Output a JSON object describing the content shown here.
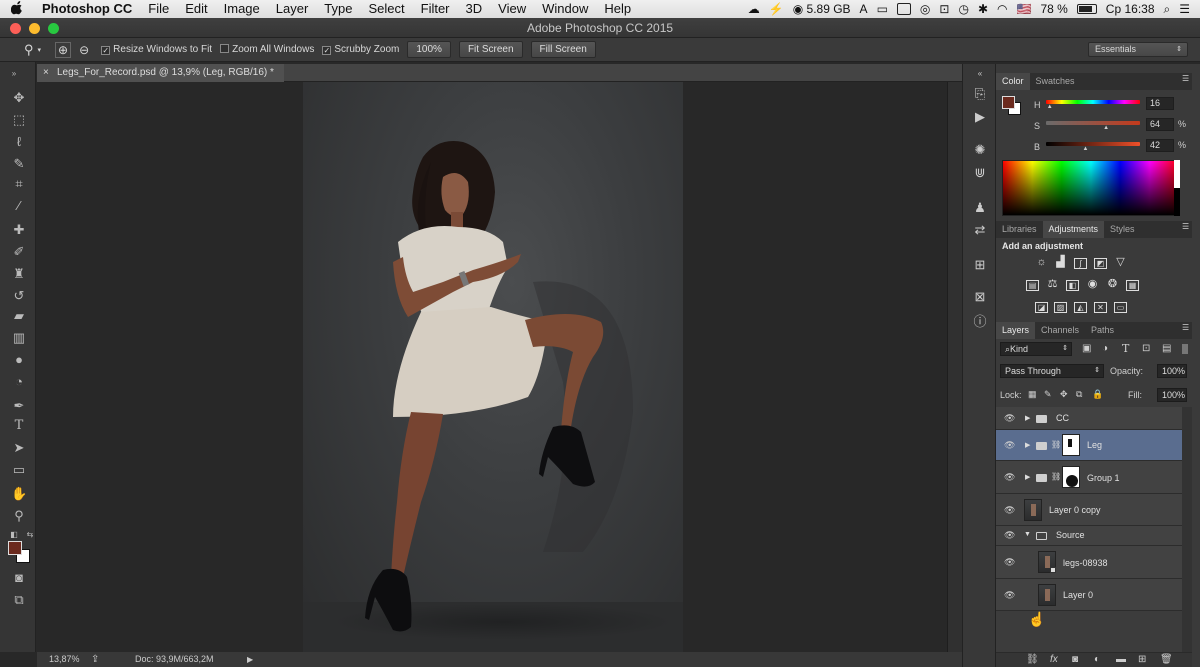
{
  "menubar": {
    "apple": "",
    "items": [
      "Photoshop CC",
      "File",
      "Edit",
      "Image",
      "Layer",
      "Type",
      "Select",
      "Filter",
      "3D",
      "View",
      "Window",
      "Help"
    ],
    "memory": "5.89 GB",
    "flag": "🇺🇸",
    "battery": "78 %",
    "clock": "Ср 16:38"
  },
  "titlebar": {
    "title": "Adobe Photoshop CC 2015"
  },
  "options": {
    "resize_label": "Resize Windows to Fit",
    "zoom_all_label": "Zoom All Windows",
    "scrubby_label": "Scrubby Zoom",
    "btn_100": "100%",
    "btn_fit": "Fit Screen",
    "btn_fill": "Fill Screen",
    "workspace": "Essentials"
  },
  "document": {
    "tab_title": "Legs_For_Record.psd @ 13,9% (Leg, RGB/16) *",
    "close": "×"
  },
  "status": {
    "zoom": "13,87%",
    "doc": "Doc: 93,9M/663,2M"
  },
  "color_panel": {
    "tabs": [
      "Color",
      "Swatches"
    ],
    "h_label": "H",
    "h_value": "16",
    "s_label": "S",
    "s_value": "64",
    "s_unit": "%",
    "b_label": "B",
    "b_value": "42",
    "b_unit": "%",
    "fg_color": "#6b2a1e",
    "h_level": 0.04,
    "s_level": 0.64,
    "b_level": 0.42
  },
  "adjustments_panel": {
    "tabs": [
      "Libraries",
      "Adjustments",
      "Styles"
    ],
    "heading": "Add an adjustment"
  },
  "layers_panel": {
    "tabs": [
      "Layers",
      "Channels",
      "Paths"
    ],
    "filter": "Kind",
    "blend_mode": "Pass Through",
    "opacity_label": "Opacity:",
    "opacity": "100%",
    "lock_label": "Lock:",
    "fill_label": "Fill:",
    "fill": "100%",
    "layers": [
      {
        "name": "CC"
      },
      {
        "name": "Leg"
      },
      {
        "name": "Group 1"
      },
      {
        "name": "Layer 0 copy"
      },
      {
        "name": "Source"
      },
      {
        "name": "legs-08938"
      },
      {
        "name": "Layer 0"
      }
    ]
  }
}
